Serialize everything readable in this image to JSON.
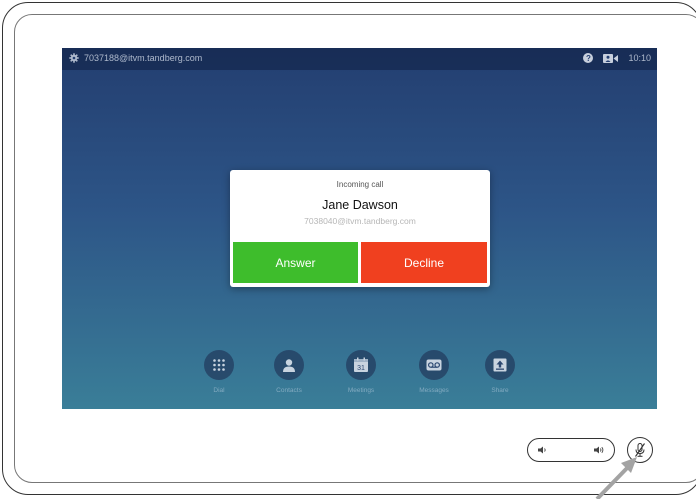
{
  "status_bar": {
    "uri": "7037188@itvm.tandberg.com",
    "help_glyph": "?",
    "time": "10:10"
  },
  "incoming_call": {
    "header": "Incoming call",
    "caller_name": "Jane Dawson",
    "caller_uri": "7038040@itvm.tandberg.com",
    "answer_label": "Answer",
    "decline_label": "Decline"
  },
  "dock": {
    "items": [
      {
        "label": "Dial",
        "icon": "keypad-icon"
      },
      {
        "label": "Contacts",
        "icon": "person-icon"
      },
      {
        "label": "Meetings",
        "icon": "calendar-icon",
        "day": "31"
      },
      {
        "label": "Messages",
        "icon": "voicemail-icon"
      },
      {
        "label": "Share",
        "icon": "share-upload-icon"
      }
    ]
  },
  "colors": {
    "answer": "#3ebd2c",
    "decline": "#f0401f",
    "screen_top": "#233e70",
    "screen_bottom": "#3a7e98"
  }
}
